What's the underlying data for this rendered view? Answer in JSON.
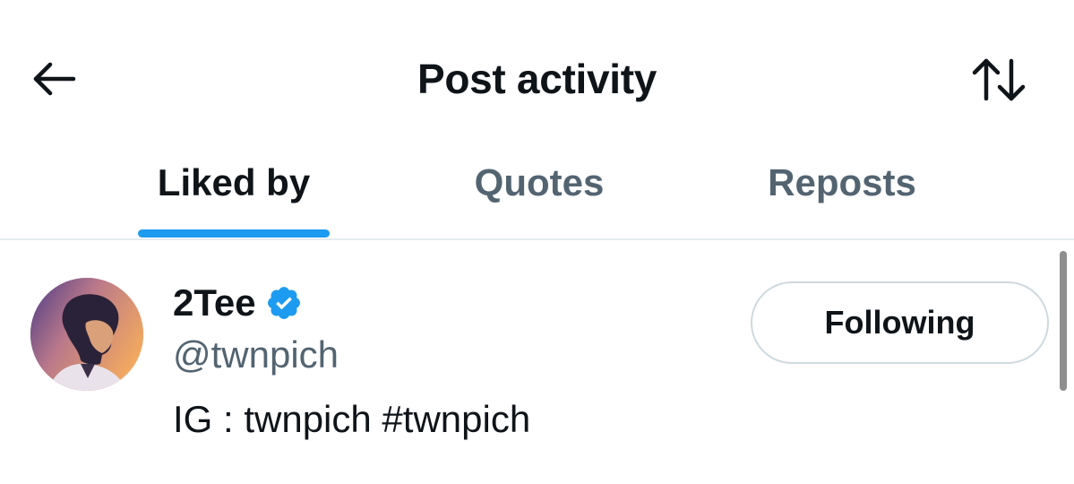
{
  "header": {
    "title": "Post activity",
    "back_icon": "arrow-left-icon",
    "sort_icon": "sort-arrows-icon"
  },
  "tabs": [
    {
      "label": "Liked by",
      "active": true
    },
    {
      "label": "Quotes",
      "active": false
    },
    {
      "label": "Reposts",
      "active": false
    }
  ],
  "users": [
    {
      "display_name": "2Tee",
      "verified": true,
      "handle": "@twnpich",
      "bio": "IG : twnpich #twnpich",
      "follow_label": "Following"
    }
  ],
  "colors": {
    "accent": "#1d9bf0",
    "text_primary": "#0f1419",
    "text_secondary": "#536471",
    "border": "#cfd9de"
  }
}
